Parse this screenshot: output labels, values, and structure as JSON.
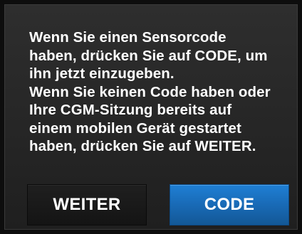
{
  "dialog": {
    "message_lines": [
      "Wenn Sie einen Sensorcode",
      "haben, drücken Sie auf CODE, um",
      "ihn jetzt einzugeben.",
      "Wenn Sie keinen Code haben oder",
      "Ihre CGM-Sitzung bereits auf",
      "einem mobilen Gerät gestartet",
      "haben, drücken Sie auf WEITER."
    ],
    "buttons": {
      "weiter_label": "WEITER",
      "code_label": "CODE"
    }
  },
  "colors": {
    "background": "#282828",
    "text": "#ffffff",
    "primary_button": "#1868b3",
    "secondary_button": "#161616"
  }
}
